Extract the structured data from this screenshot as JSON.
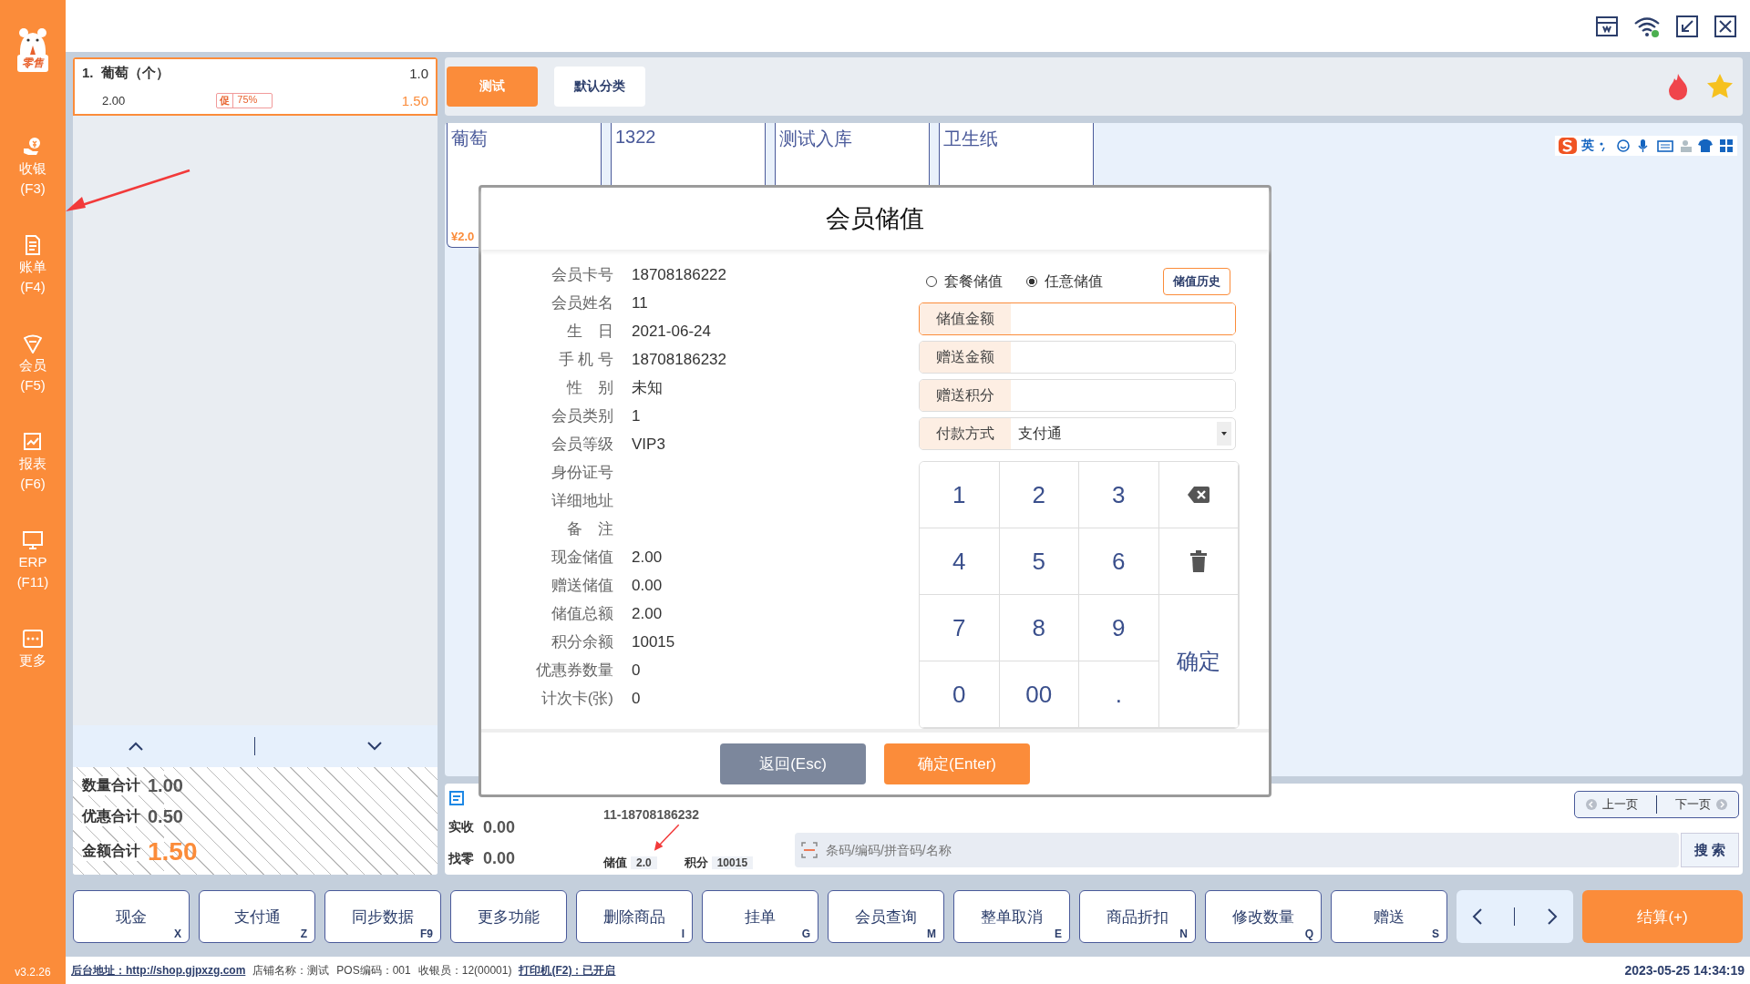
{
  "sidebar": {
    "logo_text": "零售",
    "items": [
      {
        "label": "收银",
        "key": "(F3)"
      },
      {
        "label": "账单",
        "key": "(F4)"
      },
      {
        "label": "会员",
        "key": "(F5)"
      },
      {
        "label": "报表",
        "key": "(F6)"
      },
      {
        "label": "ERP",
        "key": "(F11)"
      },
      {
        "label": "更多"
      }
    ],
    "version": "v3.2.26"
  },
  "cart": {
    "items": [
      {
        "index": "1.",
        "name": "葡萄（个）",
        "qty": "1.0",
        "price": "2.00",
        "promo_tag": "促",
        "promo": "75%",
        "amount": "1.50",
        "selected": true
      }
    ],
    "totals": [
      {
        "label": "数量合计",
        "value": "1.00",
        "kind": "plain"
      },
      {
        "label": "优惠合计",
        "value": "0.50",
        "kind": "plain"
      },
      {
        "label": "金额合计",
        "value": "1.50",
        "kind": "highlight"
      }
    ]
  },
  "categories": [
    {
      "label": "测试",
      "selected": true
    },
    {
      "label": "默认分类",
      "selected": false
    }
  ],
  "products": [
    {
      "name": "葡萄",
      "price": "¥2.0"
    },
    {
      "name": "1322"
    },
    {
      "name": "测试入库"
    },
    {
      "name": "卫生纸"
    }
  ],
  "ime": {
    "mode": "英"
  },
  "payment_info": {
    "received_label": "实收",
    "received": "0.00",
    "change_label": "找零",
    "change": "0.00",
    "member": "11-18708186232",
    "stored_label": "储值",
    "stored": "2.0",
    "points_label": "积分",
    "points": "10015"
  },
  "search": {
    "placeholder": "条码/编码/拼音码/名称",
    "button": "搜 索"
  },
  "pager": {
    "prev": "上一页",
    "next": "下一页"
  },
  "actions": [
    {
      "label": "现金",
      "key": "X"
    },
    {
      "label": "支付通",
      "key": "Z"
    },
    {
      "label": "同步数据",
      "key": "F9"
    },
    {
      "label": "更多功能"
    },
    {
      "label": "删除商品",
      "key": "I"
    },
    {
      "label": "挂单",
      "key": "G"
    },
    {
      "label": "会员查询",
      "key": "M"
    },
    {
      "label": "整单取消",
      "key": "E"
    },
    {
      "label": "商品折扣",
      "key": "N"
    },
    {
      "label": "修改数量",
      "key": "Q"
    },
    {
      "label": "赠送",
      "key": "S"
    }
  ],
  "checkout": "结算(+)",
  "status_bar": {
    "items": [
      {
        "text": "后台地址：http://shop.gjpxzg.com",
        "underline": true
      },
      {
        "text": "店铺名称：测试",
        "underline": false
      },
      {
        "text": "POS编码：001",
        "underline": false
      },
      {
        "text": "收银员：12(00001)",
        "underline": false
      },
      {
        "text": "打印机(F2)：已开启",
        "underline": true
      }
    ],
    "datetime": "2023-05-25 14:34:19"
  },
  "dialog": {
    "title": "会员储值",
    "fields": [
      {
        "label": "会员卡号",
        "value": "18708186222"
      },
      {
        "label": "会员姓名",
        "value": "11"
      },
      {
        "label": "生　日",
        "value": "2021-06-24"
      },
      {
        "label": "手 机 号",
        "value": "18708186232"
      },
      {
        "label": "性　别",
        "value": "未知"
      },
      {
        "label": "会员类别",
        "value": "1"
      },
      {
        "label": "会员等级",
        "value": "VIP3"
      },
      {
        "label": "身份证号"
      },
      {
        "label": "详细地址"
      },
      {
        "label": "备　注"
      },
      {
        "label": "现金储值",
        "value": "2.00"
      },
      {
        "label": "赠送储值",
        "value": "0.00"
      },
      {
        "label": "储值总额",
        "value": "2.00"
      },
      {
        "label": "积分余额",
        "value": "10015"
      },
      {
        "label": "优惠券数量",
        "value": "0"
      },
      {
        "label": "计次卡(张)",
        "value": "0"
      }
    ],
    "modes": [
      {
        "label": "套餐储值",
        "selected": false
      },
      {
        "label": "任意储值",
        "selected": true
      }
    ],
    "history_button": "储值历史",
    "inputs": [
      {
        "label": "储值金额",
        "kind": "text",
        "focused": true
      },
      {
        "label": "赠送金额",
        "kind": "text",
        "focused": false
      },
      {
        "label": "赠送积分",
        "kind": "text",
        "focused": false
      },
      {
        "label": "付款方式",
        "kind": "select",
        "value": "支付通",
        "focused": false
      }
    ],
    "keypad": [
      {
        "kind": "key",
        "label": "1"
      },
      {
        "kind": "key",
        "label": "2"
      },
      {
        "kind": "key",
        "label": "3"
      },
      {
        "kind": "backspace"
      },
      {
        "kind": "key",
        "label": "4"
      },
      {
        "kind": "key",
        "label": "5"
      },
      {
        "kind": "key",
        "label": "6"
      },
      {
        "kind": "clear"
      },
      {
        "kind": "key",
        "label": "7"
      },
      {
        "kind": "key",
        "label": "8"
      },
      {
        "kind": "key",
        "label": "9"
      },
      {
        "kind": "confirm",
        "label": "确定"
      },
      {
        "kind": "key",
        "label": "0"
      },
      {
        "kind": "key",
        "label": "00"
      },
      {
        "kind": "key",
        "label": "."
      }
    ],
    "cancel": "返回(Esc)",
    "ok": "确定(Enter)"
  }
}
